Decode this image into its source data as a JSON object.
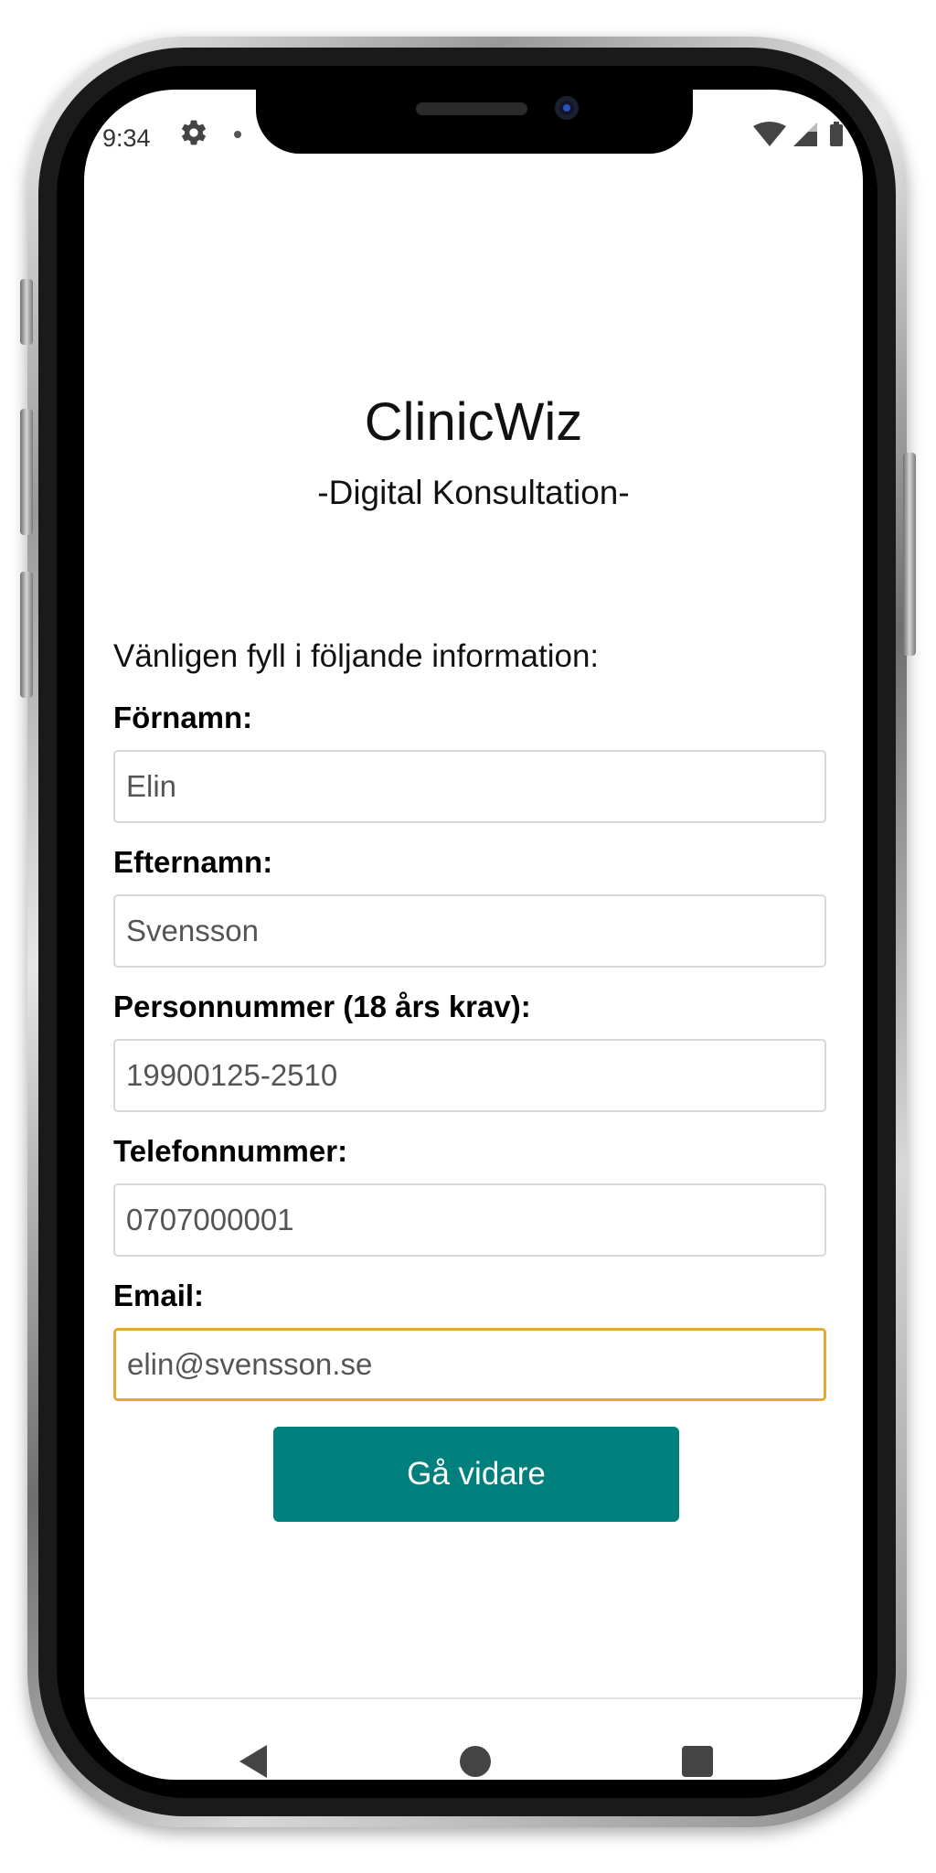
{
  "status_bar": {
    "time": "9:34",
    "icons": [
      "gear-icon",
      "notification-dot-icon",
      "wifi-icon",
      "cell-signal-icon",
      "battery-icon"
    ]
  },
  "app": {
    "title": "ClinicWiz",
    "subtitle": "-Digital Konsultation-"
  },
  "form": {
    "intro": "Vänligen fyll i följande information:",
    "fields": [
      {
        "label": "Förnamn:",
        "value": "Elin"
      },
      {
        "label": "Efternamn:",
        "value": "Svensson"
      },
      {
        "label": "Personnummer (18 års krav):",
        "value": "19900125-2510"
      },
      {
        "label": "Telefonnummer:",
        "value": "0707000001"
      },
      {
        "label": "Email:",
        "value": "elin@svensson.se",
        "focused": true
      }
    ],
    "submit_label": "Gå vidare"
  },
  "navigation": {
    "icons": [
      "back-icon",
      "home-icon",
      "recents-icon"
    ]
  },
  "colors": {
    "button": "#00807c",
    "focus_border": "#e2a93a",
    "input_border": "#d8d8d8"
  }
}
